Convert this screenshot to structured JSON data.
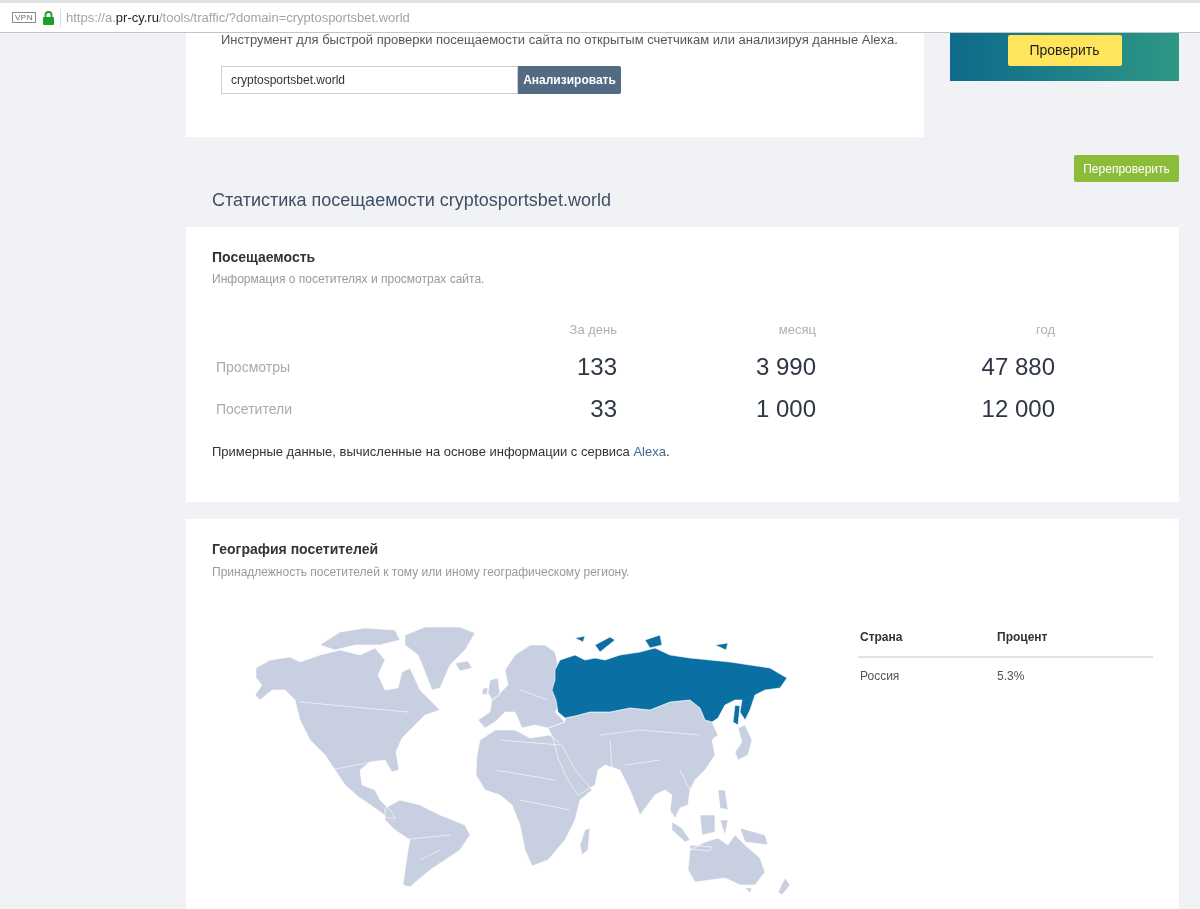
{
  "browser": {
    "vpn_badge": "VPN",
    "url": {
      "prefix": "https://a.",
      "host": "pr-cy.ru",
      "path": "/tools/traffic/?domain=cryptosportsbet.world"
    }
  },
  "tool_card": {
    "description": "Инструмент для быстрой проверки посещаемости сайта по открытым счетчикам или анализируя данные Alexa.",
    "domain_input": {
      "value": "cryptosportsbet.world"
    },
    "analyze_button": "Анализировать"
  },
  "ad_banner": {
    "button": "Проверить"
  },
  "recheck_button": "Перепроверить",
  "page_title": "Статистика посещаемости cryptosportsbet.world",
  "traffic": {
    "title": "Посещаемость",
    "subtitle": "Информация о посетителях и просмотрах сайта.",
    "columns": [
      "За день",
      "месяц",
      "год"
    ],
    "rows": [
      {
        "label": "Просмотры",
        "values": [
          "133",
          "3 990",
          "47 880"
        ]
      },
      {
        "label": "Посетители",
        "values": [
          "33",
          "1 000",
          "12 000"
        ]
      }
    ],
    "note": {
      "text": "Примерные данные, вычисленные на основе информации с сервиса ",
      "link": "Alexa",
      "end": "."
    }
  },
  "geography": {
    "title": "География посетителей",
    "subtitle": "Принадлежность посетителей к тому или иному географическому региону.",
    "table": {
      "columns": [
        "Страна",
        "Процент"
      ],
      "rows": [
        {
          "country": "Россия",
          "percent": "5.3%"
        }
      ]
    }
  }
}
